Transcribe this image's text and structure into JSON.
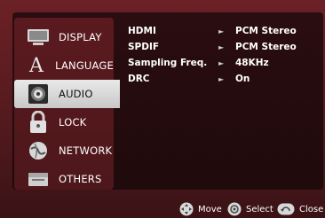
{
  "sidebar": {
    "items": [
      {
        "label": "DISPLAY",
        "icon": "display-icon"
      },
      {
        "label": "LANGUAGE",
        "icon": "language-icon"
      },
      {
        "label": "AUDIO",
        "icon": "audio-icon",
        "active": true
      },
      {
        "label": "LOCK",
        "icon": "lock-icon"
      },
      {
        "label": "NETWORK",
        "icon": "network-icon"
      },
      {
        "label": "OTHERS",
        "icon": "others-icon"
      }
    ]
  },
  "audio_settings": [
    {
      "label": "HDMI",
      "value": "PCM Stereo"
    },
    {
      "label": "SPDIF",
      "value": "PCM Stereo"
    },
    {
      "label": "Sampling Freq.",
      "value": "48KHz"
    },
    {
      "label": "DRC",
      "value": "On"
    }
  ],
  "footer": {
    "move_label": "Move",
    "select_label": "Select",
    "close_label": "Close"
  },
  "colors": {
    "background": "#5a1b1f",
    "panel": "#2a0d10",
    "active_item": "#e0e0e0"
  }
}
